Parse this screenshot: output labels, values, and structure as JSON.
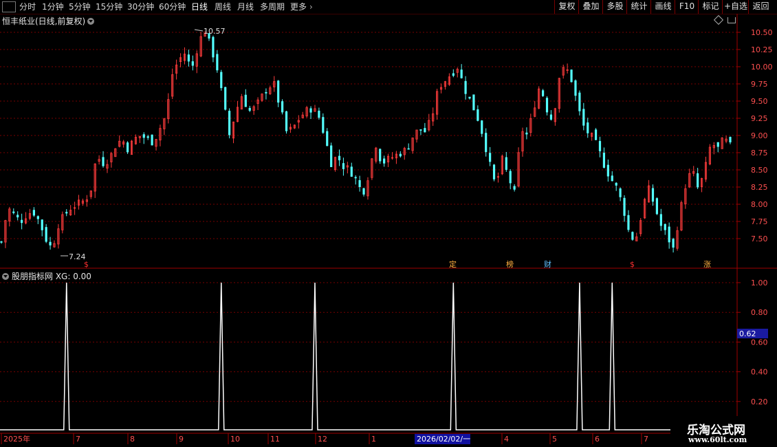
{
  "toolbar": {
    "periods": [
      "分时",
      "1分钟",
      "5分钟",
      "15分钟",
      "30分钟",
      "60分钟",
      "日线",
      "周线",
      "月线",
      "多周期",
      "更多"
    ],
    "active_period": "日线",
    "right_buttons": [
      "复权",
      "叠加",
      "多股",
      "统计",
      "画线",
      "F10",
      "标记",
      "+自选",
      "返回"
    ]
  },
  "main_chart": {
    "title": "恒丰纸业(日线,前复权)",
    "high_label": "10.57",
    "low_label": "7.24",
    "price_axis": [
      "10.50",
      "10.25",
      "10.00",
      "9.75",
      "9.50",
      "9.25",
      "9.00",
      "8.75",
      "8.50",
      "8.25",
      "8.00",
      "7.75",
      "7.50"
    ],
    "markers": [
      "$",
      "定",
      "榜",
      "财",
      "$",
      "涨"
    ]
  },
  "indicator": {
    "title": "股朋指标网 XG: 0.00",
    "axis": [
      "1.00",
      "0.80",
      "0.60",
      "0.40",
      "0.20"
    ],
    "current_value": "0.62"
  },
  "date_axis": {
    "labels": [
      "2025年",
      "7",
      "8",
      "9",
      "10",
      "11",
      "12",
      "1",
      "4",
      "5",
      "6",
      "7"
    ],
    "cursor_date": "2026/02/02/一"
  },
  "watermark": {
    "name": "乐淘公式网",
    "url": "www.60lt.com"
  },
  "colors": {
    "up": "#ff3c3c",
    "down": "#54ffff",
    "grid": "#7a0000",
    "highlight": "#1010a0"
  },
  "chart_data": [
    {
      "type": "candlestick",
      "title": "恒丰纸业(日线,前复权)",
      "ylim": [
        7.2,
        10.6
      ],
      "y_ticks": [
        7.5,
        7.75,
        8.0,
        8.25,
        8.5,
        8.75,
        9.0,
        9.25,
        9.5,
        9.75,
        10.0,
        10.25,
        10.5
      ],
      "high": 10.57,
      "low": 7.24,
      "close_path": [
        7.45,
        7.95,
        7.85,
        7.75,
        7.85,
        7.9,
        7.75,
        7.5,
        7.35,
        7.7,
        7.85,
        7.95,
        8.0,
        8.05,
        8.15,
        8.7,
        8.6,
        8.65,
        8.85,
        8.95,
        8.8,
        8.95,
        9.0,
        8.95,
        8.9,
        9.1,
        9.3,
        9.9,
        10.1,
        10.2,
        9.95,
        10.3,
        10.55,
        10.3,
        10.0,
        9.5,
        9.0,
        9.35,
        9.6,
        9.35,
        9.4,
        9.55,
        9.7,
        9.75,
        9.4,
        9.05,
        9.1,
        9.25,
        9.35,
        9.4,
        9.3,
        9.0,
        8.6,
        8.7,
        8.55,
        8.5,
        8.35,
        8.15,
        8.45,
        8.9,
        8.6,
        8.65,
        8.7,
        8.75,
        8.8,
        9.0,
        9.1,
        9.05,
        9.3,
        9.7,
        9.8,
        9.9,
        10.0,
        9.7,
        9.5,
        9.3,
        9.0,
        8.6,
        8.25,
        8.65,
        8.4,
        8.15,
        9.1,
        9.0,
        9.4,
        9.75,
        9.4,
        9.2,
        9.85,
        10.0,
        9.8,
        9.4,
        9.1,
        9.0,
        8.85,
        8.6,
        8.4,
        8.25,
        8.0,
        7.6,
        7.45,
        7.85,
        8.25,
        8.0,
        7.7,
        7.55,
        7.35,
        7.85,
        8.3,
        8.5,
        8.2,
        8.5,
        8.9,
        8.8,
        8.95,
        8.85
      ],
      "volume": []
    },
    {
      "type": "line",
      "title": "股朋指标网 XG: 0.00",
      "ylim": [
        0,
        1.05
      ],
      "y_ticks": [
        0.2,
        0.4,
        0.6,
        0.8,
        1.0
      ],
      "series": [
        {
          "name": "XG",
          "spikes_at_bar_index": [
            16,
            54,
            77,
            111,
            142,
            150
          ],
          "spike_value": 1.0,
          "base_value": 0.0
        }
      ]
    }
  ]
}
